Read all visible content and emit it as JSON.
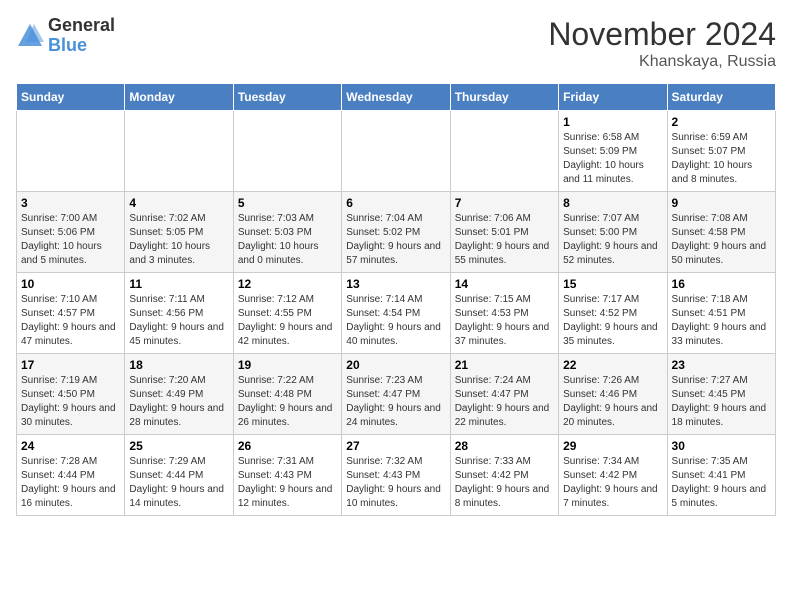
{
  "header": {
    "logo_general": "General",
    "logo_blue": "Blue",
    "month": "November 2024",
    "location": "Khanskaya, Russia"
  },
  "days_of_week": [
    "Sunday",
    "Monday",
    "Tuesday",
    "Wednesday",
    "Thursday",
    "Friday",
    "Saturday"
  ],
  "weeks": [
    [
      {
        "day": "",
        "info": ""
      },
      {
        "day": "",
        "info": ""
      },
      {
        "day": "",
        "info": ""
      },
      {
        "day": "",
        "info": ""
      },
      {
        "day": "",
        "info": ""
      },
      {
        "day": "1",
        "info": "Sunrise: 6:58 AM\nSunset: 5:09 PM\nDaylight: 10 hours and 11 minutes."
      },
      {
        "day": "2",
        "info": "Sunrise: 6:59 AM\nSunset: 5:07 PM\nDaylight: 10 hours and 8 minutes."
      }
    ],
    [
      {
        "day": "3",
        "info": "Sunrise: 7:00 AM\nSunset: 5:06 PM\nDaylight: 10 hours and 5 minutes."
      },
      {
        "day": "4",
        "info": "Sunrise: 7:02 AM\nSunset: 5:05 PM\nDaylight: 10 hours and 3 minutes."
      },
      {
        "day": "5",
        "info": "Sunrise: 7:03 AM\nSunset: 5:03 PM\nDaylight: 10 hours and 0 minutes."
      },
      {
        "day": "6",
        "info": "Sunrise: 7:04 AM\nSunset: 5:02 PM\nDaylight: 9 hours and 57 minutes."
      },
      {
        "day": "7",
        "info": "Sunrise: 7:06 AM\nSunset: 5:01 PM\nDaylight: 9 hours and 55 minutes."
      },
      {
        "day": "8",
        "info": "Sunrise: 7:07 AM\nSunset: 5:00 PM\nDaylight: 9 hours and 52 minutes."
      },
      {
        "day": "9",
        "info": "Sunrise: 7:08 AM\nSunset: 4:58 PM\nDaylight: 9 hours and 50 minutes."
      }
    ],
    [
      {
        "day": "10",
        "info": "Sunrise: 7:10 AM\nSunset: 4:57 PM\nDaylight: 9 hours and 47 minutes."
      },
      {
        "day": "11",
        "info": "Sunrise: 7:11 AM\nSunset: 4:56 PM\nDaylight: 9 hours and 45 minutes."
      },
      {
        "day": "12",
        "info": "Sunrise: 7:12 AM\nSunset: 4:55 PM\nDaylight: 9 hours and 42 minutes."
      },
      {
        "day": "13",
        "info": "Sunrise: 7:14 AM\nSunset: 4:54 PM\nDaylight: 9 hours and 40 minutes."
      },
      {
        "day": "14",
        "info": "Sunrise: 7:15 AM\nSunset: 4:53 PM\nDaylight: 9 hours and 37 minutes."
      },
      {
        "day": "15",
        "info": "Sunrise: 7:17 AM\nSunset: 4:52 PM\nDaylight: 9 hours and 35 minutes."
      },
      {
        "day": "16",
        "info": "Sunrise: 7:18 AM\nSunset: 4:51 PM\nDaylight: 9 hours and 33 minutes."
      }
    ],
    [
      {
        "day": "17",
        "info": "Sunrise: 7:19 AM\nSunset: 4:50 PM\nDaylight: 9 hours and 30 minutes."
      },
      {
        "day": "18",
        "info": "Sunrise: 7:20 AM\nSunset: 4:49 PM\nDaylight: 9 hours and 28 minutes."
      },
      {
        "day": "19",
        "info": "Sunrise: 7:22 AM\nSunset: 4:48 PM\nDaylight: 9 hours and 26 minutes."
      },
      {
        "day": "20",
        "info": "Sunrise: 7:23 AM\nSunset: 4:47 PM\nDaylight: 9 hours and 24 minutes."
      },
      {
        "day": "21",
        "info": "Sunrise: 7:24 AM\nSunset: 4:47 PM\nDaylight: 9 hours and 22 minutes."
      },
      {
        "day": "22",
        "info": "Sunrise: 7:26 AM\nSunset: 4:46 PM\nDaylight: 9 hours and 20 minutes."
      },
      {
        "day": "23",
        "info": "Sunrise: 7:27 AM\nSunset: 4:45 PM\nDaylight: 9 hours and 18 minutes."
      }
    ],
    [
      {
        "day": "24",
        "info": "Sunrise: 7:28 AM\nSunset: 4:44 PM\nDaylight: 9 hours and 16 minutes."
      },
      {
        "day": "25",
        "info": "Sunrise: 7:29 AM\nSunset: 4:44 PM\nDaylight: 9 hours and 14 minutes."
      },
      {
        "day": "26",
        "info": "Sunrise: 7:31 AM\nSunset: 4:43 PM\nDaylight: 9 hours and 12 minutes."
      },
      {
        "day": "27",
        "info": "Sunrise: 7:32 AM\nSunset: 4:43 PM\nDaylight: 9 hours and 10 minutes."
      },
      {
        "day": "28",
        "info": "Sunrise: 7:33 AM\nSunset: 4:42 PM\nDaylight: 9 hours and 8 minutes."
      },
      {
        "day": "29",
        "info": "Sunrise: 7:34 AM\nSunset: 4:42 PM\nDaylight: 9 hours and 7 minutes."
      },
      {
        "day": "30",
        "info": "Sunrise: 7:35 AM\nSunset: 4:41 PM\nDaylight: 9 hours and 5 minutes."
      }
    ]
  ]
}
